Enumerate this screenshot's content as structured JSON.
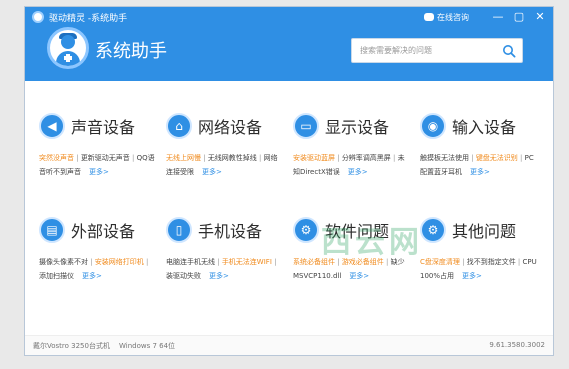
{
  "window": {
    "title": "驱动精灵 -系统助手",
    "feedback": "在线咨询",
    "minimize": "—",
    "maximize": "▢",
    "close": "✕"
  },
  "header": {
    "app_title": "系统助手",
    "search_placeholder": "搜索需要解决的问题"
  },
  "categories": [
    {
      "title": "声音设备",
      "icon": "speaker-icon",
      "glyph": "◀",
      "links": [
        {
          "text": "突然没声音",
          "highlight": true
        },
        {
          "text": "更新驱动无声音",
          "highlight": false
        },
        {
          "text": "QQ语音听不到声音",
          "highlight": false
        }
      ],
      "more": "更多>"
    },
    {
      "title": "网络设备",
      "icon": "network-icon",
      "glyph": "⌂",
      "links": [
        {
          "text": "无线上网慢",
          "highlight": true
        },
        {
          "text": "无线网教性掉线",
          "highlight": false
        },
        {
          "text": "网络连接受限",
          "highlight": false
        }
      ],
      "more": "更多>"
    },
    {
      "title": "显示设备",
      "icon": "monitor-icon",
      "glyph": "▭",
      "links": [
        {
          "text": "安装驱动蓝屏",
          "highlight": true
        },
        {
          "text": "分辨率调高黑屏",
          "highlight": false
        },
        {
          "text": "未知DirectX错误",
          "highlight": false
        }
      ],
      "more": "更多>"
    },
    {
      "title": "输入设备",
      "icon": "mouse-icon",
      "glyph": "◉",
      "links": [
        {
          "text": "触摸板无法使用",
          "highlight": false
        },
        {
          "text": "键盘无法识别",
          "highlight": true
        },
        {
          "text": "PC配置蓝牙耳机",
          "highlight": false
        }
      ],
      "more": "更多>"
    },
    {
      "title": "外部设备",
      "icon": "printer-icon",
      "glyph": "▤",
      "links": [
        {
          "text": "摄像头像素不对",
          "highlight": false
        },
        {
          "text": "安装网络打印机",
          "highlight": true
        },
        {
          "text": "添加扫描仪",
          "highlight": false
        }
      ],
      "more": "更多>"
    },
    {
      "title": "手机设备",
      "icon": "phone-icon",
      "glyph": "▯",
      "links": [
        {
          "text": "电脑连手机无线",
          "highlight": false
        },
        {
          "text": "手机无法连WIFI",
          "highlight": true
        },
        {
          "text": "装驱动失败",
          "highlight": false
        }
      ],
      "more": "更多>"
    },
    {
      "title": "软件问题",
      "icon": "gear-icon",
      "glyph": "⚙",
      "links": [
        {
          "text": "系统必备组件",
          "highlight": true
        },
        {
          "text": "游戏必备组件",
          "highlight": true
        },
        {
          "text": "缺少MSVCP110.dll",
          "highlight": false
        }
      ],
      "more": "更多>"
    },
    {
      "title": "其他问题",
      "icon": "settings-icon",
      "glyph": "⚙",
      "links": [
        {
          "text": "C盘深度清理",
          "highlight": true
        },
        {
          "text": "找不到指定文件",
          "highlight": false
        },
        {
          "text": "CPU 100%占用",
          "highlight": false
        }
      ],
      "more": "更多>"
    }
  ],
  "watermark": "西云网",
  "status": {
    "pc_model": "戴尔Vostro 3250台式机",
    "os": "Windows 7 64位",
    "version": "9.61.3580.3002"
  },
  "colors": {
    "header_blue": "#2f8fe4",
    "link_orange": "#f08a1c",
    "more_blue": "#2f8fe4"
  }
}
